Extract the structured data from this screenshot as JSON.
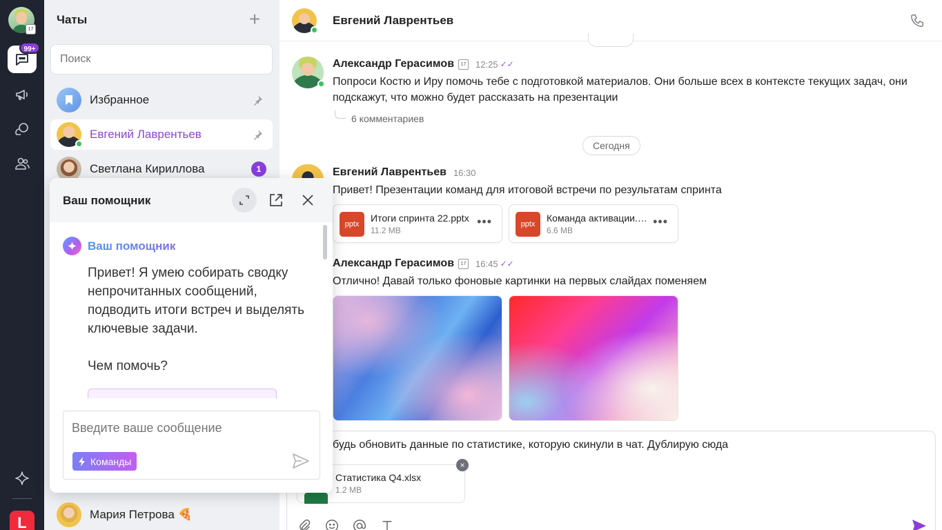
{
  "rail": {
    "badge": "99+",
    "logo_letter": "L"
  },
  "chats": {
    "title": "Чаты",
    "search_placeholder": "Поиск",
    "items": [
      {
        "name": "Избранное"
      },
      {
        "name": "Евгений Лаврентьев"
      },
      {
        "name": "Светлана Кириллова",
        "unread": "1"
      },
      {
        "name": "Мария Петрова 🍕"
      }
    ]
  },
  "main": {
    "header_name": "Евгений Лаврентьев",
    "date_today": "Сегодня",
    "messages": [
      {
        "author": "Александр Герасимов",
        "time": "12:25",
        "ticks": "✓✓",
        "text": "Попроси Костю и Иру помочь тебе с подготовкой материалов. Они больше всех в контексте текущих задач, они подскажут, что можно будет рассказать на презентации",
        "comments": "6 комментариев"
      },
      {
        "author": "Евгений Лаврентьев",
        "time": "16:30",
        "text": "Привет! Презентации команд для итоговой встречи по результатам спринта",
        "files": [
          {
            "ext": "pptx",
            "name": "Итоги спринта 22.pptx",
            "size": "11.2 MB",
            "more": "•••"
          },
          {
            "ext": "pptx",
            "name": "Команда активации.pptx",
            "size": "6.6 MB",
            "more": "•••"
          }
        ]
      },
      {
        "author": "Александр Герасимов",
        "time": "16:45",
        "ticks": "✓✓",
        "text": "Отлично! Давай только фоновые картинки на первых слайдах поменяем"
      }
    ],
    "composer": {
      "text": "будь обновить данные по статистике, которую скинули в чат. Дублирую сюда",
      "attachment": {
        "name": "Статистика Q4.xlsx",
        "size": "1.2 MB"
      },
      "remove": "×"
    }
  },
  "assistant": {
    "title": "Ваш помощник",
    "bot_name": "Ваш помощник",
    "greeting": "Привет! Я умею собирать сводку непрочитанных сообщений, подводить итоги встреч и выделять ключевые задачи.",
    "ask": "Чем помочь?",
    "input_placeholder": "Введите ваше сообщение",
    "commands_label": "Команды"
  },
  "colors": {
    "accent": "#8a3ddb",
    "rail_bg": "#1f2430",
    "online": "#3fbf5e"
  }
}
